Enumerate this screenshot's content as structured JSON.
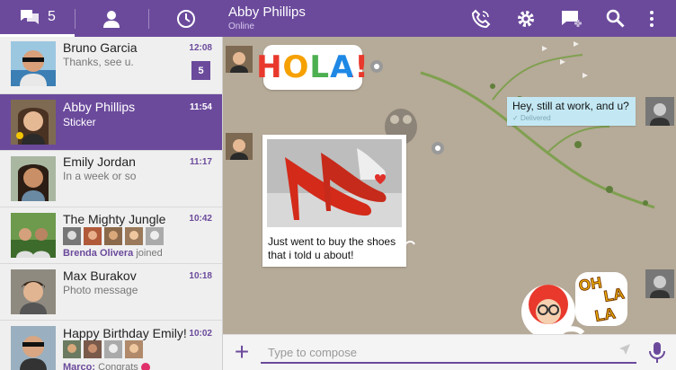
{
  "tabs": {
    "chats_count": "5"
  },
  "header": {
    "contact_name": "Abby Phillips",
    "contact_status": "Online"
  },
  "conversations": [
    {
      "name": "Bruno Garcia",
      "message": "Thanks, see u.",
      "time": "12:08",
      "unread": "5"
    },
    {
      "name": "Abby Phillips",
      "message": "Sticker",
      "time": "11:54"
    },
    {
      "name": "Emily Jordan",
      "message": "In a week or so",
      "time": "11:17"
    },
    {
      "name": "The Mighty Jungle",
      "time": "10:42",
      "sub_name": "Brenda Olivera",
      "sub_text": " joined"
    },
    {
      "name": "Max Burakov",
      "message": "Photo message",
      "time": "10:18"
    },
    {
      "name": "Happy Birthday Emily!",
      "time": "10:02",
      "sub_name": "Marco:",
      "sub_text": " Congrats"
    }
  ],
  "messages": {
    "sticker_hola": "HOLA!",
    "outgoing_text": "Hey, still at work, and u?",
    "outgoing_status": "Delivered",
    "photo_caption": "Just went to buy the shoes that i told u about!",
    "sticker_oh": "OH",
    "sticker_la1": "LA",
    "sticker_la2": "LA"
  },
  "compose": {
    "placeholder": "Type to compose"
  },
  "colors": {
    "accent": "#6b4a9c",
    "outgoing_bubble": "#c3e8f3",
    "chat_background": "#b6aa98"
  }
}
